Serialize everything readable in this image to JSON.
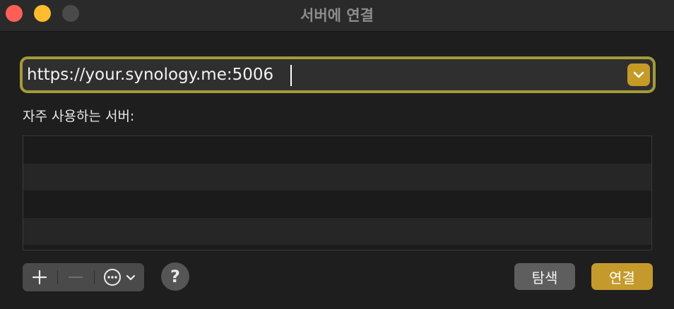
{
  "window": {
    "title": "서버에 연결"
  },
  "address": {
    "value": "https://your.synology.me:5006"
  },
  "favorites": {
    "label": "자주 사용하는 서버:",
    "items": []
  },
  "toolbar": {
    "add_icon": "plus-icon",
    "remove_icon": "minus-icon",
    "more_icon": "ellipsis-circle-icon",
    "help_label": "?"
  },
  "buttons": {
    "browse": "탐색",
    "connect": "연결"
  },
  "colors": {
    "accent": "#c49a2c",
    "focus_ring": "#a39a3a",
    "close": "#ff5f57",
    "minimize": "#febc2e",
    "maximize_disabled": "#4a4a4a"
  }
}
